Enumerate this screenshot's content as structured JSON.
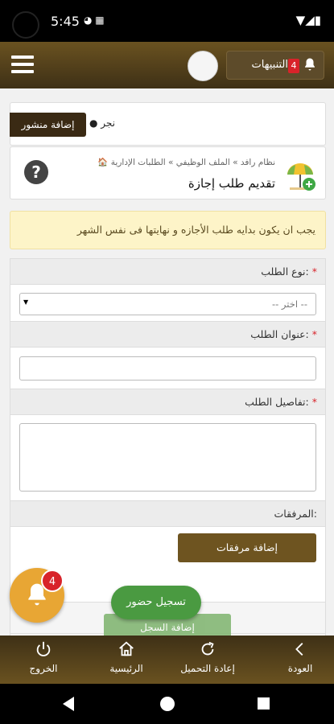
{
  "status_bar": {
    "time": "5:45",
    "notif_icons": "◕ ▦",
    "right_icons": "▼◢▮"
  },
  "app_bar": {
    "notifications_label": "التنبيهات",
    "notifications_count": "4",
    "bell_glyph": "🔔"
  },
  "post_bar": {
    "add_post_label": "إضافة منشور",
    "text": "● نجر"
  },
  "header": {
    "breadcrumb": "🏠 نظام رافد » الملف الوظيفي » الطلبات الإدارية",
    "title": "تقديم طلب إجازة",
    "help_glyph": "?"
  },
  "alert": {
    "text": "يجب ان يكون بدايه طلب الأجازه و نهايتها فى نفس الشهر"
  },
  "form": {
    "request_type_label": "نوع الطلب:",
    "request_type_placeholder": "-- اختر --",
    "request_title_label": "عنوان الطلب:",
    "request_details_label": "تفاصيل الطلب:",
    "attachments_label": "المرفقات:",
    "add_attachments_button": "إضافة مرفقات",
    "required_mark": "*",
    "hidden_submit_label": "إضافة السجل"
  },
  "floating": {
    "badge_count": "4",
    "attend_label": "تسجيل حضور"
  },
  "bottom_nav": {
    "items": [
      {
        "label": "العودة",
        "icon": "chevron-left"
      },
      {
        "label": "إعادة التحميل",
        "icon": "reload"
      },
      {
        "label": "الرئيسية",
        "icon": "home"
      },
      {
        "label": "الخروج",
        "icon": "power"
      }
    ]
  },
  "colors": {
    "brand_brown": "#6a5220",
    "attend_green": "#4a9a41",
    "badge_red": "#d8232a",
    "alert_bg": "#fdf4c8"
  }
}
